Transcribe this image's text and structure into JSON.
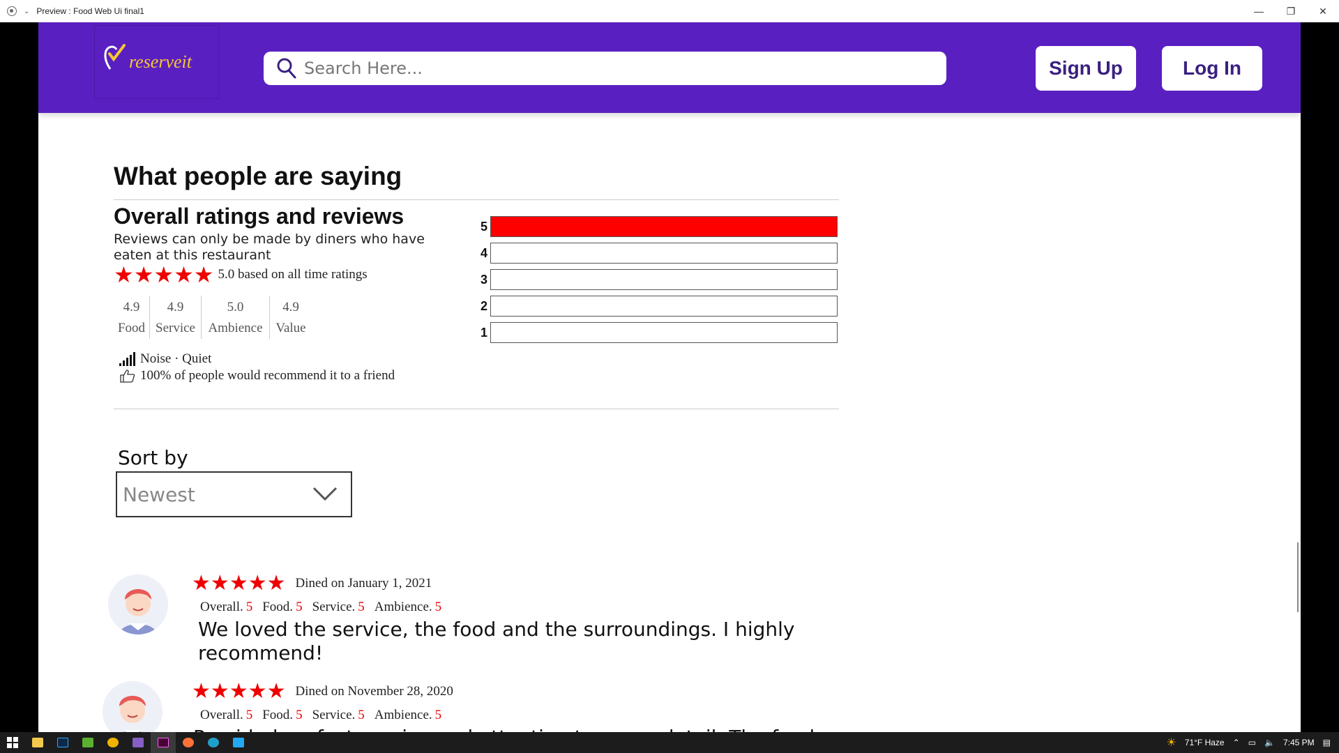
{
  "window": {
    "title": "Preview : Food Web Ui final1"
  },
  "header": {
    "logo_text": "reserveit",
    "search_placeholder": "Search Here...",
    "signup_label": "Sign Up",
    "login_label": "Log In",
    "brand_color": "#5a1fc1"
  },
  "reviews_section": {
    "heading": "What people are saying",
    "subheading": "Overall ratings and reviews",
    "note": "Reviews can only be made by diners who have eaten at this restaurant",
    "rating_stars": 5,
    "rating_summary": "5.0 based on all time ratings",
    "categories": [
      {
        "value": "4.9",
        "label": "Food"
      },
      {
        "value": "4.9",
        "label": "Service"
      },
      {
        "value": "5.0",
        "label": "Ambience"
      },
      {
        "value": "4.9",
        "label": "Value"
      }
    ],
    "noise": "Noise · Quiet",
    "recommend": "100% of people would recommend it to a friend",
    "distribution": [
      {
        "stars": "5",
        "fraction": 1.0
      },
      {
        "stars": "4",
        "fraction": 0
      },
      {
        "stars": "3",
        "fraction": 0
      },
      {
        "stars": "2",
        "fraction": 0
      },
      {
        "stars": "1",
        "fraction": 0
      }
    ],
    "accent_color": "#ff0000"
  },
  "sort": {
    "label": "Sort by",
    "value": "Newest"
  },
  "reviews": [
    {
      "stars": 5,
      "date": "Dined on January 1, 2021",
      "scores": [
        {
          "label": "Overall.",
          "value": "5"
        },
        {
          "label": "Food.",
          "value": "5"
        },
        {
          "label": "Service.",
          "value": "5"
        },
        {
          "label": "Ambience.",
          "value": "5"
        }
      ],
      "text": "We loved the service, the food and the surroundings. I highly recommend!"
    },
    {
      "stars": 5,
      "date": "Dined on November 28, 2020",
      "scores": [
        {
          "label": "Overall.",
          "value": "5"
        },
        {
          "label": "Food.",
          "value": "5"
        },
        {
          "label": "Service.",
          "value": "5"
        },
        {
          "label": "Ambience.",
          "value": "5"
        }
      ],
      "text": "Provided perfect service and attention to every detail. The food"
    }
  ],
  "taskbar": {
    "weather": "71°F  Haze",
    "time": "7:45 PM"
  }
}
